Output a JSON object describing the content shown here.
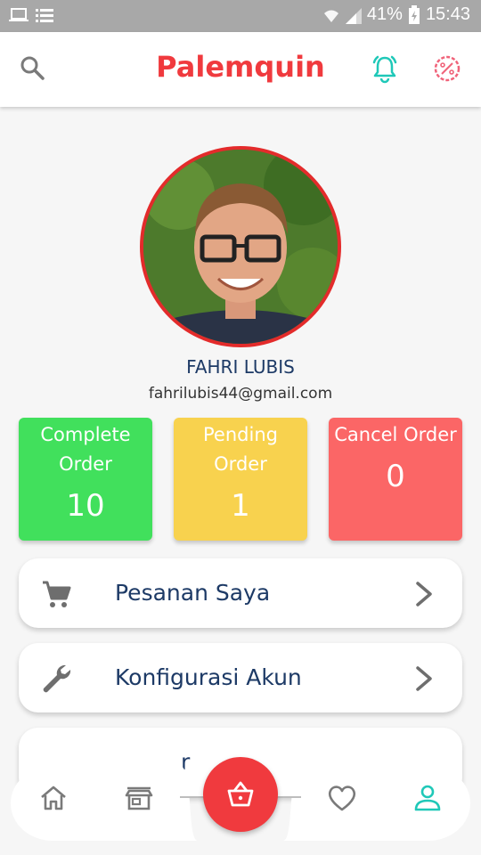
{
  "status_bar": {
    "battery": "41%",
    "time": "15:43"
  },
  "app_bar": {
    "title": "Palemquin",
    "icons": [
      "search-icon",
      "bell-icon",
      "discount-icon"
    ]
  },
  "profile": {
    "name": "FAHRI LUBIS",
    "email": "fahrilubis44@gmail.com",
    "avatar": "profile-photo"
  },
  "orders": [
    {
      "label": "Complete Order",
      "value": "10",
      "color": "#41e05c"
    },
    {
      "label": "Pending Order",
      "value": "1",
      "color": "#f8d24e"
    },
    {
      "label": "Cancel Order",
      "value": "0",
      "color": "#fb6666"
    }
  ],
  "menu": [
    {
      "label": "Pesanan Saya",
      "icon": "cart-icon"
    },
    {
      "label": "Konfigurasi Akun",
      "icon": "wrench-icon"
    },
    {
      "label": "r",
      "icon": ""
    }
  ],
  "bottom_nav": {
    "items": [
      "home-icon",
      "store-icon",
      "basket-icon",
      "heart-icon",
      "profile-icon"
    ],
    "active": "profile-icon"
  },
  "colors": {
    "brand": "#f03a3e",
    "accent": "#1fc8b8",
    "navy": "#1d3a66"
  }
}
